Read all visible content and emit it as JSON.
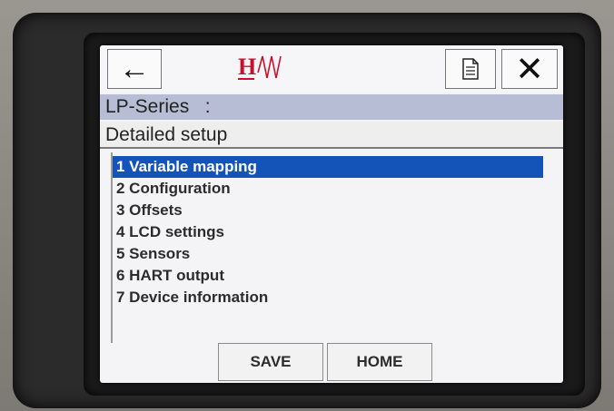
{
  "toolbar": {
    "back_icon": "arrow-left-icon",
    "back_glyph": "←",
    "logo_letter": "H",
    "logo_icon": "wave-logo",
    "document_icon": "document-icon",
    "close_icon": "close-icon",
    "close_glyph": "✕"
  },
  "device_name": "LP-Series   :",
  "page_title": "Detailed setup",
  "menu": {
    "items": [
      {
        "label": "1 Variable mapping",
        "selected": true
      },
      {
        "label": "2 Configuration",
        "selected": false
      },
      {
        "label": "3 Offsets",
        "selected": false
      },
      {
        "label": "4 LCD settings",
        "selected": false
      },
      {
        "label": "5 Sensors",
        "selected": false
      },
      {
        "label": "6 HART output",
        "selected": false
      },
      {
        "label": "7 Device information",
        "selected": false
      }
    ]
  },
  "buttons": {
    "save": "SAVE",
    "home": "HOME"
  },
  "colors": {
    "selection": "#1454b8",
    "device_bar": "#b6bdd4",
    "logo_red": "#c8102e"
  }
}
